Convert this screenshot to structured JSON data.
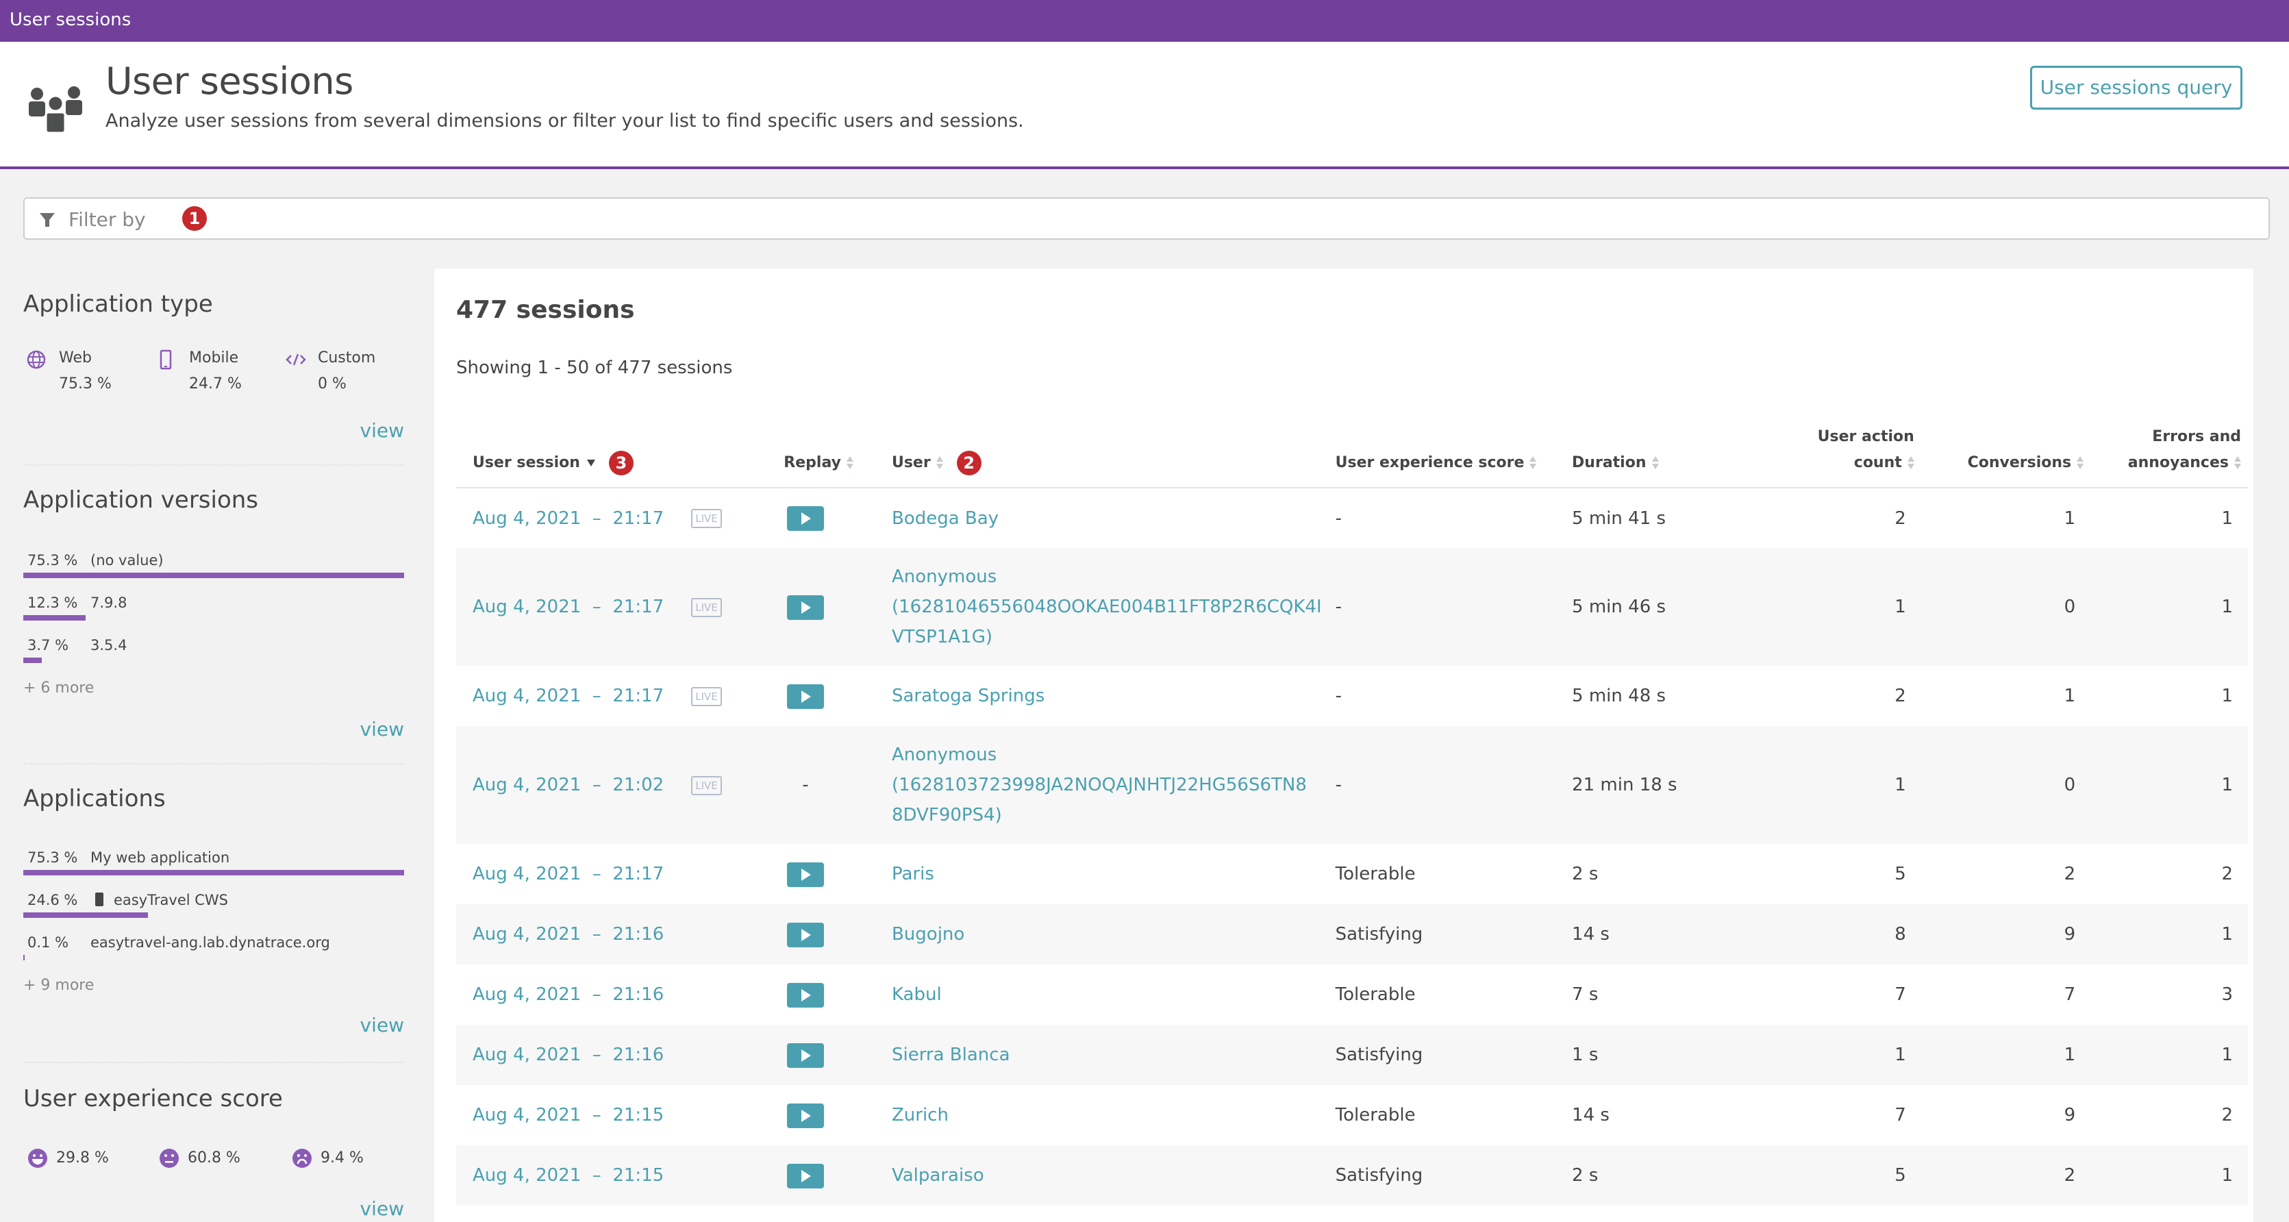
{
  "topbar": {
    "title": "User sessions"
  },
  "header": {
    "icon": "users-group-icon",
    "title": "User sessions",
    "subtitle": "Analyze user sessions from several dimensions or filter your list to find specific users and sessions.",
    "query_button": "User sessions query"
  },
  "filter": {
    "icon": "filter-icon",
    "placeholder": "Filter by",
    "marker": "1"
  },
  "sidebar": {
    "application_type": {
      "title": "Application type",
      "items": [
        {
          "icon": "globe-icon",
          "label": "Web",
          "percent": "75.3 %"
        },
        {
          "icon": "mobile-icon",
          "label": "Mobile",
          "percent": "24.7 %"
        },
        {
          "icon": "code-icon",
          "label": "Custom",
          "percent": "0 %"
        }
      ],
      "view": "view"
    },
    "application_versions": {
      "title": "Application versions",
      "items": [
        {
          "percent": "75.3 %",
          "name": "(no value)",
          "value": 75.3
        },
        {
          "percent": "12.3 %",
          "name": "7.9.8",
          "value": 12.3
        },
        {
          "percent": "3.7 %",
          "name": "3.5.4",
          "value": 3.7
        }
      ],
      "more": "+ 6 more",
      "view": "view"
    },
    "applications": {
      "title": "Applications",
      "items": [
        {
          "percent": "75.3 %",
          "name": "My web application",
          "value": 75.3
        },
        {
          "percent": "24.6 %",
          "name": "easyTravel CWS",
          "value": 24.6,
          "icon": "mobile-app-icon"
        },
        {
          "percent": "0.1 %",
          "name": "easytravel-ang.lab.dynatrace.org",
          "value": 0.1
        }
      ],
      "more": "+ 9 more",
      "view": "view"
    },
    "ux_score": {
      "title": "User experience score",
      "items": [
        {
          "icon": "satisfied-face-icon",
          "percent": "29.8 %"
        },
        {
          "icon": "neutral-face-icon",
          "percent": "60.8 %"
        },
        {
          "icon": "frustrated-face-icon",
          "percent": "9.4 %"
        }
      ],
      "view": "view"
    }
  },
  "main": {
    "title": "477 sessions",
    "showing": "Showing 1 - 50 of 477 sessions",
    "columns": {
      "session": "User session",
      "session_marker": "3",
      "replay": "Replay",
      "user": "User",
      "user_marker": "2",
      "ux": "User experience score",
      "duration": "Duration",
      "actions_1": "User action",
      "actions_2": "count",
      "conversions": "Conversions",
      "errors_1": "Errors and",
      "errors_2": "annoyances"
    },
    "live_label": "LIVE",
    "rows": [
      {
        "session": "Aug 4, 2021  –  21:17",
        "live": true,
        "replay": true,
        "user": [
          "Bodega Bay"
        ],
        "ux": "-",
        "duration": "5 min 41 s",
        "actions": "2",
        "conversions": "1",
        "errors": "1"
      },
      {
        "session": "Aug 4, 2021  –  21:17",
        "live": true,
        "replay": true,
        "user": [
          "Anonymous",
          "(16281046556048OOKAE004B11FT8P2R6CQK4I",
          "VTSP1A1G)"
        ],
        "ux": "-",
        "duration": "5 min 46 s",
        "actions": "1",
        "conversions": "0",
        "errors": "1"
      },
      {
        "session": "Aug 4, 2021  –  21:17",
        "live": true,
        "replay": true,
        "user": [
          "Saratoga Springs"
        ],
        "ux": "-",
        "duration": "5 min 48 s",
        "actions": "2",
        "conversions": "1",
        "errors": "1"
      },
      {
        "session": "Aug 4, 2021  –  21:02",
        "live": true,
        "replay": false,
        "replay_text": "-",
        "user": [
          "Anonymous",
          "(1628103723998JA2NOQAJNHTJ22HG56S6TN8",
          "8DVF90PS4)"
        ],
        "ux": "-",
        "duration": "21 min 18 s",
        "actions": "1",
        "conversions": "0",
        "errors": "1"
      },
      {
        "session": "Aug 4, 2021  –  21:17",
        "live": false,
        "replay": true,
        "user": [
          "Paris"
        ],
        "ux": "Tolerable",
        "duration": "2 s",
        "actions": "5",
        "conversions": "2",
        "errors": "2"
      },
      {
        "session": "Aug 4, 2021  –  21:16",
        "live": false,
        "replay": true,
        "user": [
          "Bugojno"
        ],
        "ux": "Satisfying",
        "duration": "14 s",
        "actions": "8",
        "conversions": "9",
        "errors": "1"
      },
      {
        "session": "Aug 4, 2021  –  21:16",
        "live": false,
        "replay": true,
        "user": [
          "Kabul"
        ],
        "ux": "Tolerable",
        "duration": "7 s",
        "actions": "7",
        "conversions": "7",
        "errors": "3"
      },
      {
        "session": "Aug 4, 2021  –  21:16",
        "live": false,
        "replay": true,
        "user": [
          "Sierra Blanca"
        ],
        "ux": "Satisfying",
        "duration": "1 s",
        "actions": "1",
        "conversions": "1",
        "errors": "1"
      },
      {
        "session": "Aug 4, 2021  –  21:15",
        "live": false,
        "replay": true,
        "user": [
          "Zurich"
        ],
        "ux": "Tolerable",
        "duration": "14 s",
        "actions": "7",
        "conversions": "9",
        "errors": "2"
      },
      {
        "session": "Aug 4, 2021  –  21:15",
        "live": false,
        "replay": true,
        "user": [
          "Valparaiso"
        ],
        "ux": "Satisfying",
        "duration": "2 s",
        "actions": "5",
        "conversions": "2",
        "errors": "1"
      }
    ]
  },
  "colors": {
    "brand": "#72409a",
    "bar": "#8a5bb5",
    "link": "#4aa0b0",
    "marker": "#c6282b"
  }
}
